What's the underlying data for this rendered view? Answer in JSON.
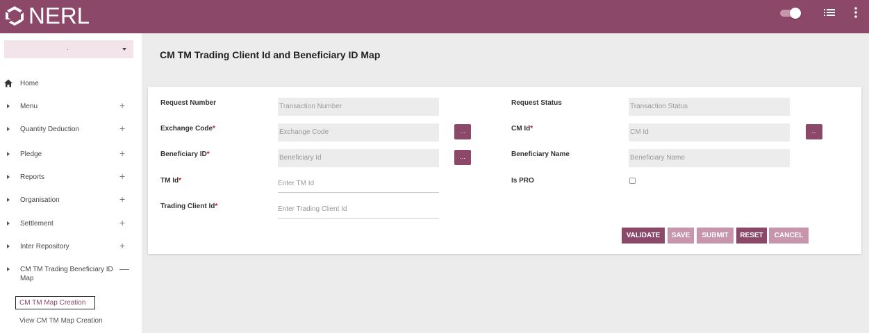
{
  "header": {
    "brand": "NERL"
  },
  "sidebar": {
    "select_value": ".",
    "home": "Home",
    "items": [
      {
        "label": "Menu",
        "expand": "+"
      },
      {
        "label": "Quantity Deduction",
        "expand": "+"
      },
      {
        "label": "Pledge",
        "expand": "+"
      },
      {
        "label": "Reports",
        "expand": "+"
      },
      {
        "label": "Organisation",
        "expand": "+"
      },
      {
        "label": "Settlement",
        "expand": "+"
      },
      {
        "label": "Inter Repository",
        "expand": "+"
      },
      {
        "label": "CM TM Trading Beneficiary ID",
        "label2": "Map",
        "expand": "—"
      }
    ],
    "subitems": [
      {
        "label": "CM TM Map Creation"
      },
      {
        "label": "View CM TM Map Creation"
      }
    ]
  },
  "main": {
    "title": "CM TM Trading Client Id and Beneficiary ID Map",
    "form": {
      "request_number": {
        "label": "Request Number",
        "placeholder": "Transaction Number"
      },
      "request_status": {
        "label": "Request Status",
        "placeholder": "Transaction Status"
      },
      "exchange_code": {
        "label": "Exchange Code",
        "required": "*",
        "placeholder": "Exchange Code"
      },
      "cm_id": {
        "label": "CM Id",
        "required": "*",
        "placeholder": "CM Id"
      },
      "beneficiary_id": {
        "label": "Beneficiary ID",
        "required": "*",
        "placeholder": "Beneficiary Id"
      },
      "beneficiary_name": {
        "label": "Beneficiary Name",
        "placeholder": "Beneficiary Name"
      },
      "tm_id": {
        "label": "TM Id",
        "required": "*",
        "placeholder": "Enter TM Id"
      },
      "is_pro": {
        "label": "Is PRO"
      },
      "trading_client_id": {
        "label": "Trading Client Id",
        "required": "*",
        "placeholder": "Enter Trading Client Id"
      },
      "lookup_label": "..."
    },
    "buttons": {
      "validate": "VALIDATE",
      "save": "SAVE",
      "submit": "SUBMIT",
      "reset": "RESET",
      "cancel": "CANCEL"
    }
  },
  "colors": {
    "brand": "#8b4868",
    "brand_light": "#c796ad",
    "required": "#c8102e"
  }
}
